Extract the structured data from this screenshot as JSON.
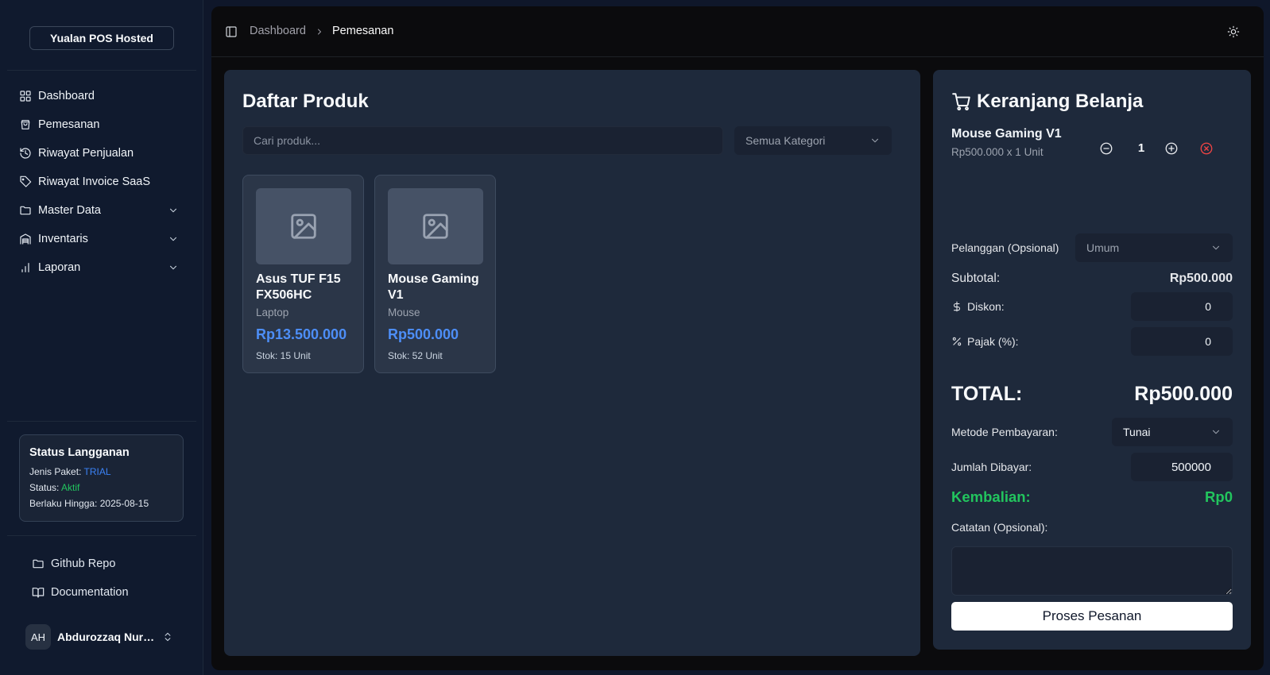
{
  "app": {
    "name": "Yualan POS Hosted"
  },
  "sidebar": {
    "items": [
      {
        "label": "Dashboard",
        "icon": "grid-icon"
      },
      {
        "label": "Pemesanan",
        "icon": "shopping-bag-icon"
      },
      {
        "label": "Riwayat Penjualan",
        "icon": "history-icon"
      },
      {
        "label": "Riwayat Invoice SaaS",
        "icon": "tag-icon"
      },
      {
        "label": "Master Data",
        "icon": "folder-icon"
      },
      {
        "label": "Inventaris",
        "icon": "warehouse-icon"
      },
      {
        "label": "Laporan",
        "icon": "bar-chart-icon"
      }
    ],
    "subscription": {
      "title": "Status Langganan",
      "plan_label": "Jenis Paket:",
      "plan_value": "TRIAL",
      "status_label": "Status:",
      "status_value": "Aktif",
      "valid_label": "Berlaku Hingga:",
      "valid_value": "2025-08-15",
      "plan_color": "#3b82f6",
      "status_color": "#22c55e"
    },
    "links": [
      {
        "label": "Github Repo",
        "icon": "folder-icon"
      },
      {
        "label": "Documentation",
        "icon": "book-open-icon"
      }
    ],
    "user": {
      "initials": "AH",
      "name": "Abdurozzaq Nuru..."
    }
  },
  "header": {
    "breadcrumb": [
      "Dashboard",
      "Pemesanan"
    ]
  },
  "products": {
    "title": "Daftar Produk",
    "search_placeholder": "Cari produk...",
    "category_selected": "Semua Kategori",
    "items": [
      {
        "name": "Asus TUF F15 FX506HC",
        "category": "Laptop",
        "price": "Rp13.500.000",
        "stock": "Stok: 15 Unit"
      },
      {
        "name": "Mouse Gaming V1",
        "category": "Mouse",
        "price": "Rp500.000",
        "stock": "Stok: 52 Unit"
      }
    ],
    "price_color": "#4d8ef7"
  },
  "cart": {
    "title": "Keranjang Belanja",
    "items": [
      {
        "name": "Mouse Gaming V1",
        "detail": "Rp500.000 x 1 Unit",
        "qty": "1"
      }
    ],
    "customer_label": "Pelanggan (Opsional)",
    "customer_value": "Umum",
    "subtotal_label": "Subtotal:",
    "subtotal_value": "Rp500.000",
    "discount_label": "Diskon:",
    "discount_value": "0",
    "tax_label": "Pajak (%):",
    "tax_value": "0",
    "total_label": "TOTAL:",
    "total_value": "Rp500.000",
    "payment_label": "Metode Pembayaran:",
    "payment_value": "Tunai",
    "paid_label": "Jumlah Dibayar:",
    "paid_value": "500000",
    "change_label": "Kembalian:",
    "change_value": "Rp0",
    "notes_label": "Catatan (Opsional):",
    "notes_value": "",
    "submit_label": "Proses Pesanan",
    "change_color": "#22c55e",
    "remove_color": "#ef4444"
  }
}
